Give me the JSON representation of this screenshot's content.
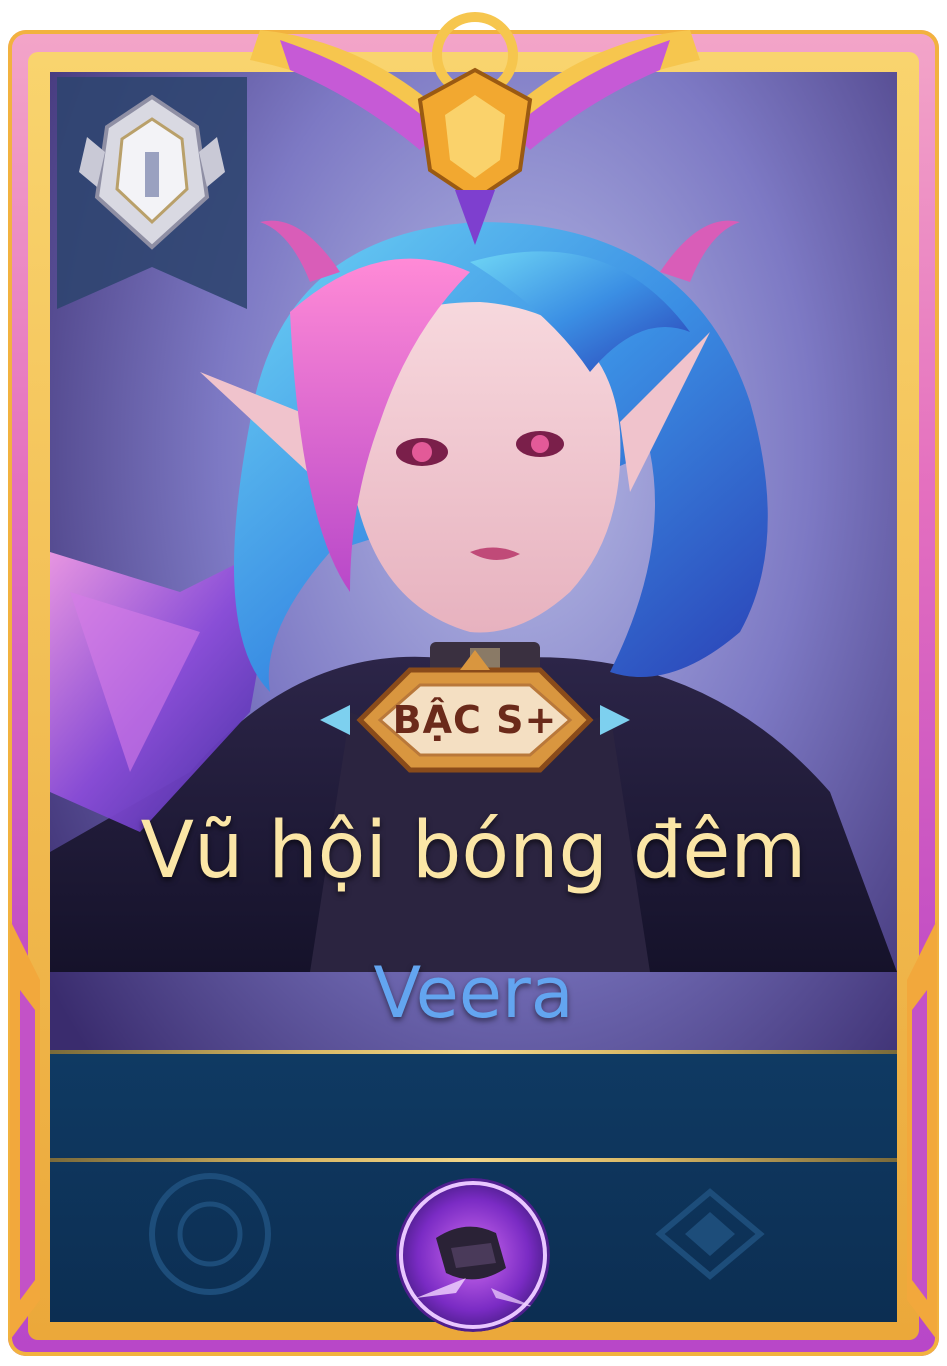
{
  "card": {
    "tier_badge": "BẬC S+",
    "skin_name": "Vũ hội bóng đêm",
    "hero_name": "Veera"
  },
  "icons": {
    "rank_emblem": "silver-rank-emblem-icon",
    "crown": "gold-winged-crown-icon",
    "skill": "hero-skill-icon"
  },
  "colors": {
    "frame_pink": "#e46fbf",
    "frame_gold": "#eba83a",
    "skin_name_text": "#fbe6a6",
    "hero_name_text": "#63a5f0",
    "bottom_panel": "#0f3a63",
    "tier_text": "#6b2a1a"
  }
}
